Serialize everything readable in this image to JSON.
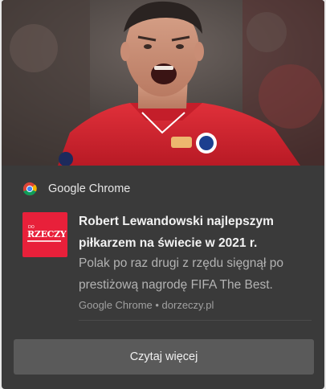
{
  "notification": {
    "app_name": "Google Chrome",
    "app_icon": "chrome-icon",
    "site_logo": {
      "name": "do-rzeczy-logo",
      "prefix": "DO",
      "text": "RZECZY",
      "color": "#e8203a"
    },
    "title": "Robert Lewandowski najlepszym piłkarzem na świecie w 2021 r.",
    "body": "Polak po raz drugi z rzędu sięgnął po prestiżową nagrodę FIFA The Best.",
    "source": "Google Chrome • dorzeczy.pl",
    "action_label": "Czytaj więcej"
  },
  "colors": {
    "card_bg": "#3a3a3a",
    "button_bg": "#5a5a5a",
    "jersey_red": "#d81d2c"
  }
}
